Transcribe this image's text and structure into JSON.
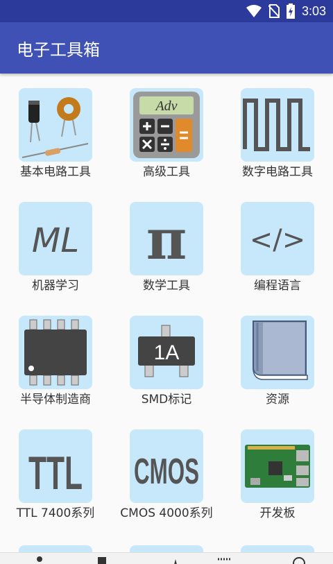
{
  "status_bar": {
    "time": "3:03",
    "icons": [
      "wifi-icon",
      "no-sim-icon",
      "battery-charging-icon"
    ]
  },
  "app_bar": {
    "title": "电子工具箱"
  },
  "colors": {
    "status_bar": "#2c3a9c",
    "app_bar": "#3f51b5",
    "tile_background": "#c7e8fb",
    "page_background": "#fafafa"
  },
  "tiles": [
    {
      "label": "基本电路工具",
      "icon": "components-icon"
    },
    {
      "label": "高级工具",
      "icon": "calculator-icon",
      "icon_text": "Adv"
    },
    {
      "label": "数字电路工具",
      "icon": "square-wave-icon"
    },
    {
      "label": "机器学习",
      "icon": "ml-icon",
      "icon_text": "ML"
    },
    {
      "label": "数学工具",
      "icon": "pi-icon",
      "icon_text": "π"
    },
    {
      "label": "编程语言",
      "icon": "code-icon",
      "icon_text": "</>"
    },
    {
      "label": "半导体制造商",
      "icon": "ic-chip-icon"
    },
    {
      "label": "SMD标记",
      "icon": "smd-chip-icon",
      "icon_text": "1A"
    },
    {
      "label": "资源",
      "icon": "book-icon"
    },
    {
      "label": "TTL 7400系列",
      "icon": "ttl-icon",
      "icon_text": "TTL"
    },
    {
      "label": "CMOS 4000系列",
      "icon": "cmos-icon",
      "icon_text": "CMOS"
    },
    {
      "label": "开发板",
      "icon": "dev-board-icon"
    }
  ]
}
